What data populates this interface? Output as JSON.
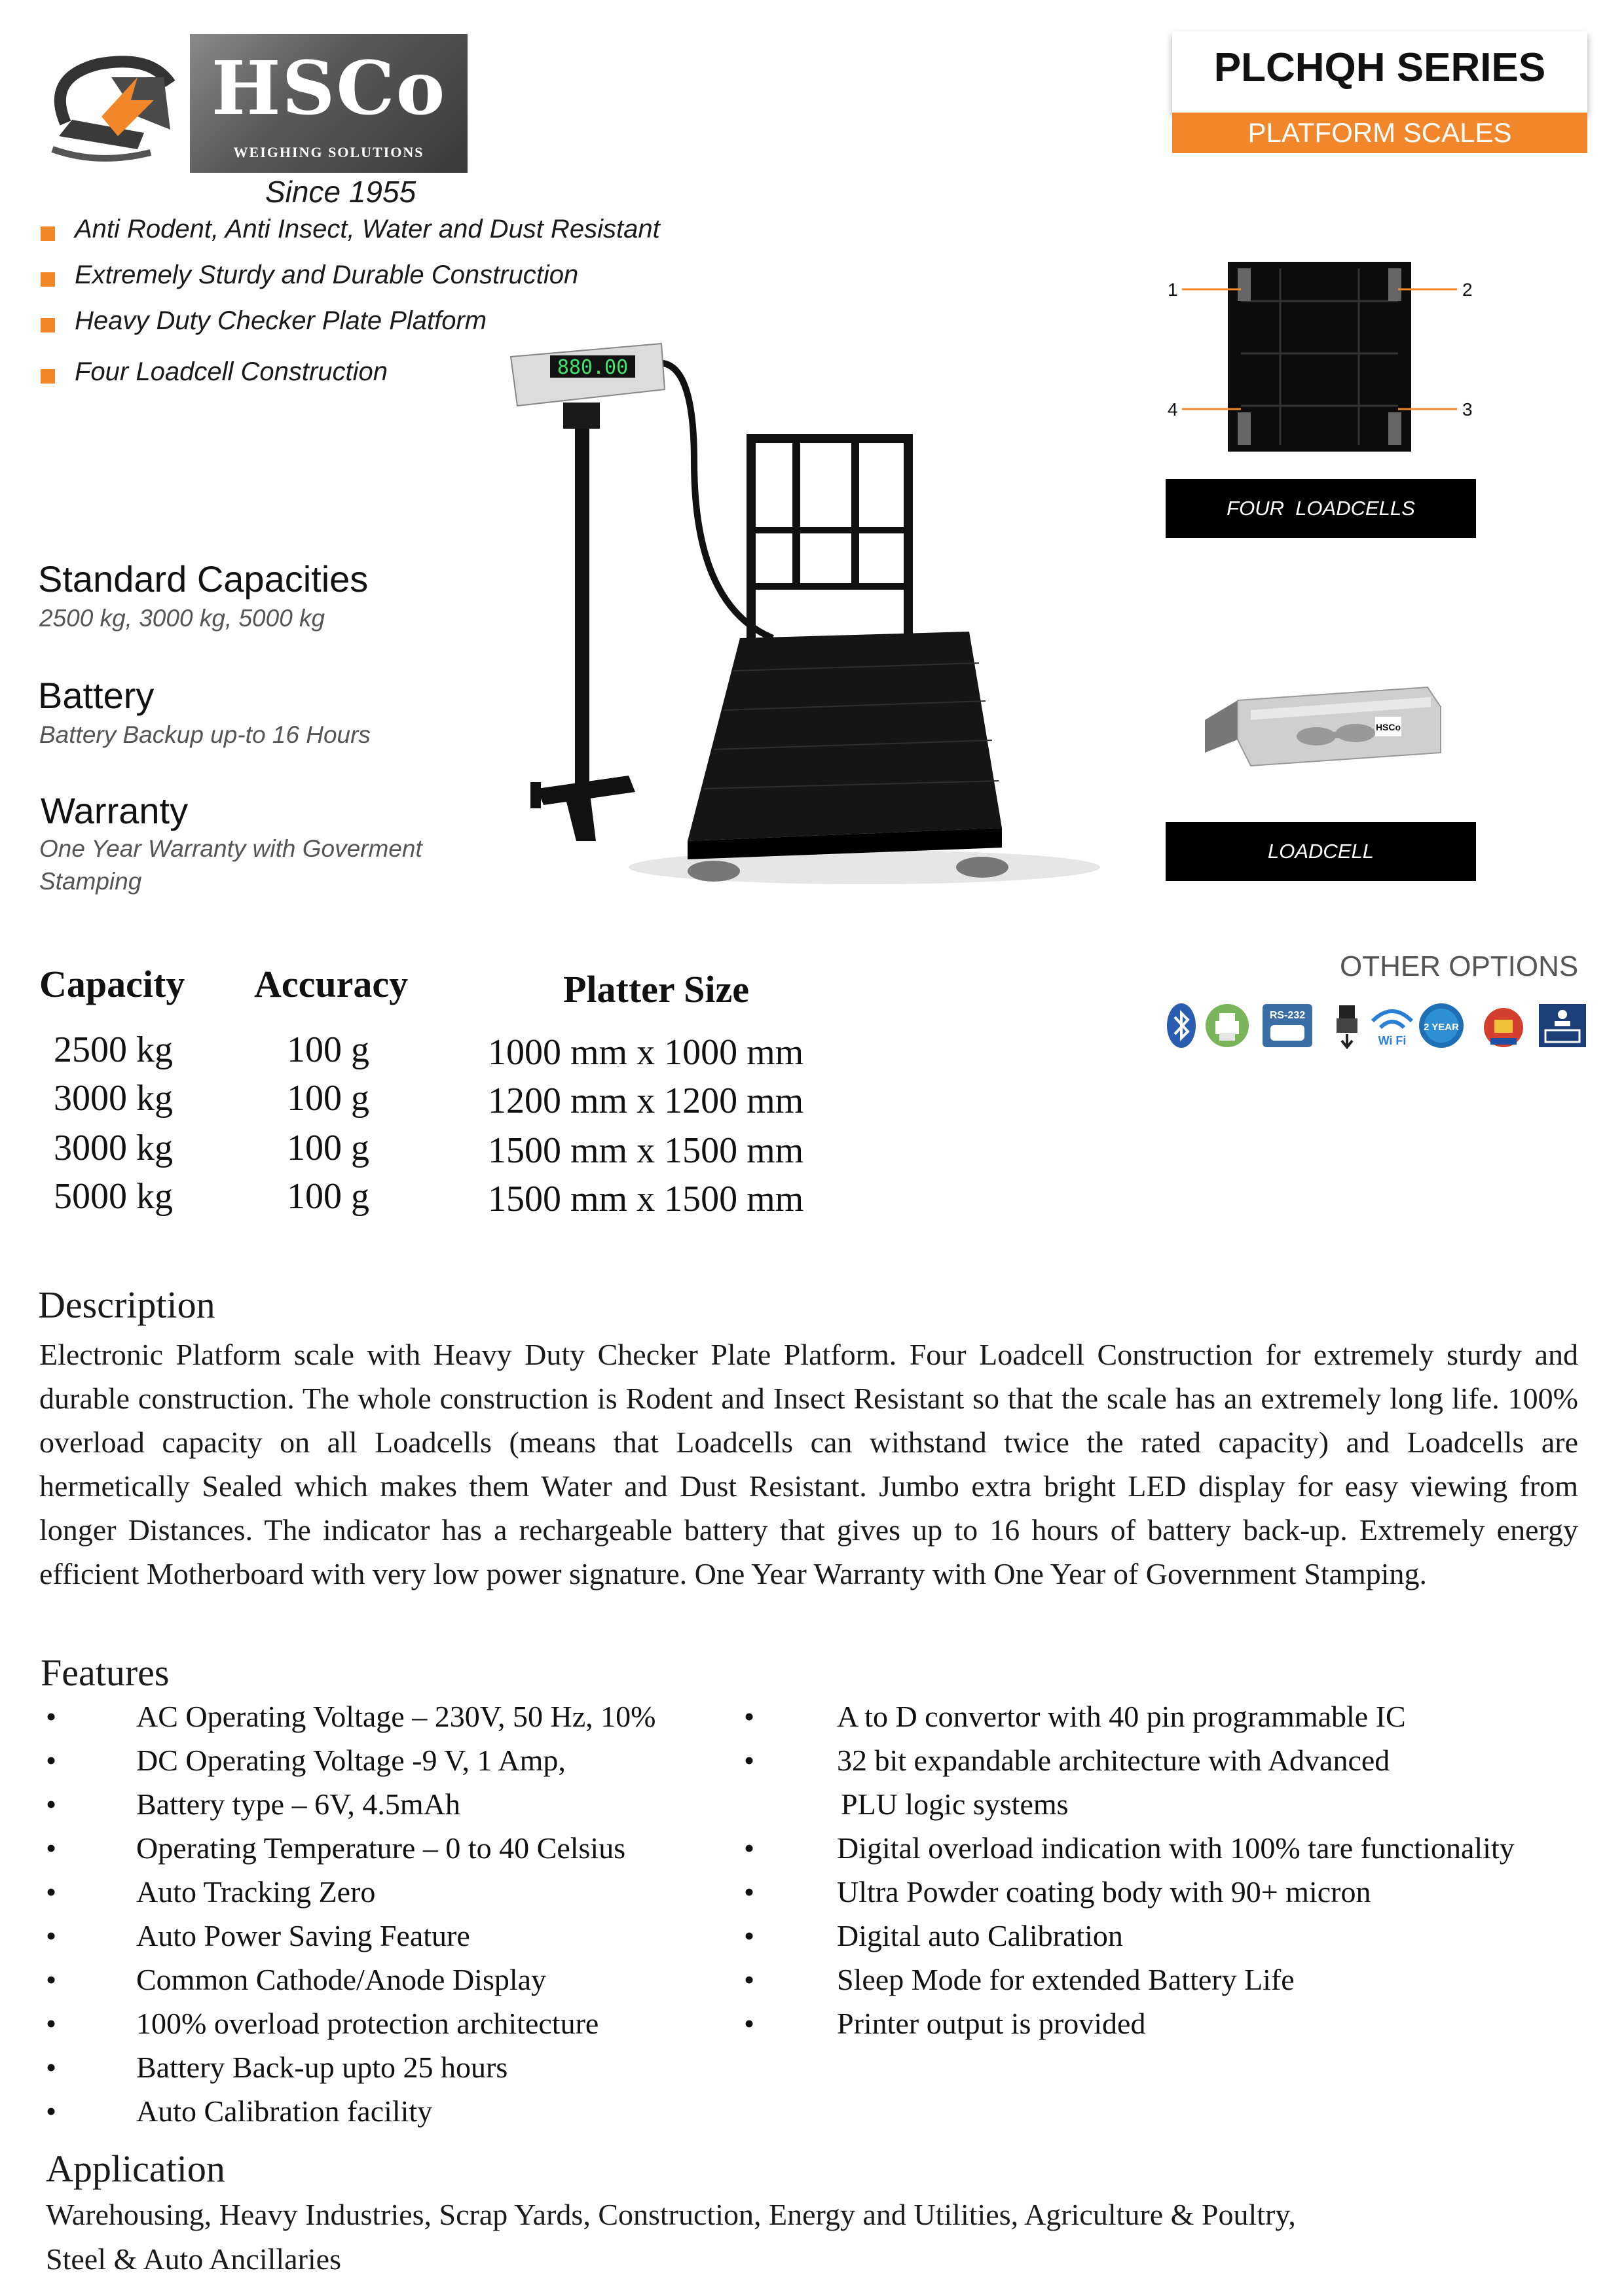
{
  "header": {
    "logo_name": "HSCo",
    "logo_tagline": "WEIGHING SOLUTIONS",
    "since": "Since 1955",
    "series_title": "PLCHQH SERIES",
    "series_subtitle": "PLATFORM SCALES",
    "accent_color": "#f2862b"
  },
  "bullets": [
    "Anti Rodent, Anti Insect,  Water and Dust Resistant",
    "Extremely Sturdy and Durable Construction",
    "Heavy Duty Checker Plate Platform",
    "Four Loadcell Construction"
  ],
  "specs": {
    "capacities_title": "Standard Capacities",
    "capacities_value": "2500 kg, 3000 kg, 5000 kg",
    "battery_title": "Battery",
    "battery_value": "Battery Backup up-to 16 Hours",
    "warranty_title": "Warranty",
    "warranty_value_line1": "One Year Warranty with Goverment",
    "warranty_value_line2": "Stamping"
  },
  "indicator_display": "880.00",
  "loadcell_panel": {
    "markers": [
      "1",
      "2",
      "3",
      "4"
    ],
    "four_loadcells_label": "FOUR  LOADCELLS",
    "loadcell_label": "LOADCELL",
    "loadcell_brand": "HSCo"
  },
  "other_options": {
    "title": "OTHER OPTIONS",
    "icons": [
      "bluetooth-icon",
      "printer-icon",
      "rs232-icon",
      "usb-icon",
      "wifi-icon",
      "warranty-badge-icon",
      "government-seal-icon",
      "scale-display-icon"
    ],
    "rs232_text": "RS-232",
    "wifi_text": "Wi Fi",
    "warranty_badge_text": "2 YEAR"
  },
  "table": {
    "headers": [
      "Capacity",
      "Accuracy",
      "Platter Size"
    ],
    "rows": [
      [
        "2500 kg",
        "100 g",
        "1000 mm x 1000 mm"
      ],
      [
        "3000 kg",
        "100 g",
        "1200 mm x 1200 mm"
      ],
      [
        "3000 kg",
        "100 g",
        "1500 mm x 1500 mm"
      ],
      [
        "5000 kg",
        "100 g",
        "1500 mm x 1500 mm"
      ]
    ]
  },
  "description": {
    "title": "Description",
    "text": "Electronic Platform scale with Heavy Duty Checker Plate Platform. Four Loadcell Construction for extremely sturdy and durable construction. The whole construction is Rodent and Insect Resistant so that the scale has an extremely long life. 100% overload capacity on all Loadcells (means that Loadcells can withstand twice the rated capacity) and Loadcells are hermetically Sealed which makes them Water and Dust Resistant. Jumbo extra bright LED display for easy viewing from longer Distances. The indicator has a rechargeable battery that gives up to 16 hours of battery back-up. Extremely energy efficient Motherboard with very low power signature. One Year Warranty with One Year of Government Stamping."
  },
  "features": {
    "title": "Features",
    "bullet_char": "•",
    "left": [
      "AC Operating Voltage – 230V, 50 Hz, 10%",
      "DC Operating Voltage -9 V, 1 Amp,",
      "Battery type – 6V, 4.5mAh",
      "Operating Temperature – 0 to 40 Celsius",
      "Auto Tracking Zero",
      "Auto Power Saving Feature",
      "Common Cathode/Anode Display",
      "100% overload protection architecture",
      "Battery Back-up upto 25 hours",
      "Auto Calibration facility"
    ],
    "right": [
      "A to D convertor with 40 pin programmable IC",
      "32 bit expandable architecture with Advanced",
      "PLU logic systems",
      "Digital overload indication with 100% tare functionality",
      "Ultra Powder coating body with 90+ micron",
      "Digital auto Calibration",
      "Sleep Mode for extended Battery Life",
      "Printer output is provided"
    ]
  },
  "application": {
    "title": "Application",
    "line1": "Warehousing, Heavy Industries, Scrap Yards, Construction, Energy and Utilities, Agriculture & Poultry,",
    "line2": "Steel & Auto Ancillaries"
  }
}
